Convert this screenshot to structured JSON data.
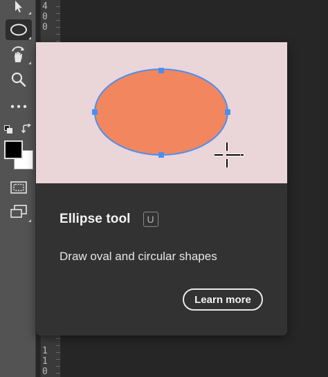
{
  "toolbar": {
    "tools": [
      {
        "name": "move-tool",
        "icon": "arrow-cursor-icon",
        "selected": false
      },
      {
        "name": "ellipse-tool",
        "icon": "ellipse-icon",
        "selected": true
      },
      {
        "name": "hand-rotate-tool",
        "icon": "hand-rotate-icon",
        "selected": false
      },
      {
        "name": "zoom-tool",
        "icon": "magnifier-icon",
        "selected": false
      },
      {
        "name": "more-tools",
        "icon": "ellipsis-icon",
        "selected": false
      },
      {
        "name": "quick-mask-mode",
        "icon": "quick-mask-icon",
        "selected": false
      },
      {
        "name": "change-screen-mode",
        "icon": "screen-mode-icon",
        "selected": false
      }
    ],
    "foreground_color": "#000000",
    "background_color": "#ffffff"
  },
  "ruler": {
    "top_label": "4\n0\n0",
    "bottom_label": "1\n1\n0"
  },
  "tooltip": {
    "title": "Ellipse tool",
    "shortcut": "U",
    "description": "Draw oval and circular shapes",
    "button_label": "Learn more",
    "colors": {
      "preview_background": "#ead5d8",
      "ellipse_fill": "#f2865f",
      "ellipse_stroke": "#4a8ff0",
      "handle": "#4a8ff0"
    }
  }
}
